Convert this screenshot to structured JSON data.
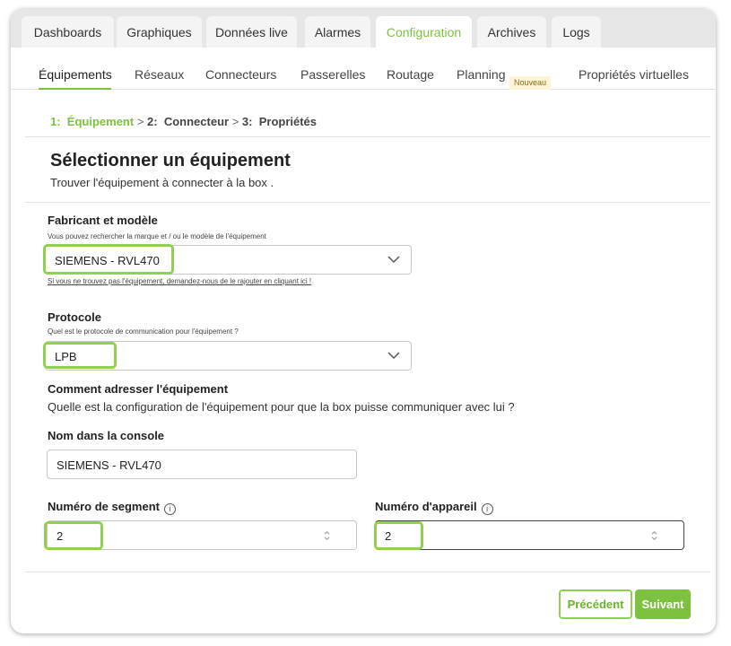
{
  "tabs": [
    {
      "label": "Dashboards"
    },
    {
      "label": "Graphiques"
    },
    {
      "label": "Données live"
    },
    {
      "label": "Alarmes"
    },
    {
      "label": "Configuration"
    },
    {
      "label": "Archives"
    },
    {
      "label": "Logs"
    }
  ],
  "active_tab": "Configuration",
  "subtabs": [
    {
      "label": "Équipements"
    },
    {
      "label": "Réseaux"
    },
    {
      "label": "Connecteurs"
    },
    {
      "label": "Passerelles"
    },
    {
      "label": "Routage"
    },
    {
      "label": "Planning"
    },
    {
      "label": "Propriétés virtuelles"
    }
  ],
  "active_subtab": "Équipements",
  "planning_badge": "Nouveau",
  "steps": {
    "step1": "1:",
    "step1_label": "Équipement",
    "sep1": ">",
    "step2": "2:",
    "step2_label": "Connecteur",
    "sep2": ">",
    "step3": "3:",
    "step3_label": "Propriétés"
  },
  "section": {
    "title": "Sélectionner un équipement",
    "subtitle": "Trouver l'équipement à connecter à la box ."
  },
  "manufacturer": {
    "label": "Fabricant et modèle",
    "hint": "Vous pouvez rechercher la marque et / ou le modèle de l'équipement",
    "value": "SIEMENS - RVL470",
    "link": "Si vous ne trouvez pas l'équipement, demandez-nous de le rajouter en cliquant ici !"
  },
  "protocol": {
    "label": "Protocole",
    "hint": "Quel est le protocole de communication pour l'équipement ?",
    "value": "LPB"
  },
  "addressing": {
    "label": "Comment adresser l'équipement",
    "desc": "Quelle est la configuration de l'équipement pour que la box puisse communiquer avec lui ?"
  },
  "console_name": {
    "label": "Nom dans la console",
    "value": "SIEMENS - RVL470"
  },
  "segment": {
    "label": "Numéro de segment",
    "value": "2"
  },
  "device": {
    "label": "Numéro d'appareil",
    "value": "2"
  },
  "info_glyph": "i",
  "buttons": {
    "prev": "Précédent",
    "next": "Suivant"
  },
  "colors": {
    "accent": "#7cc23f",
    "highlight": "#8fd14f",
    "badge_bg": "#fff4d6"
  }
}
